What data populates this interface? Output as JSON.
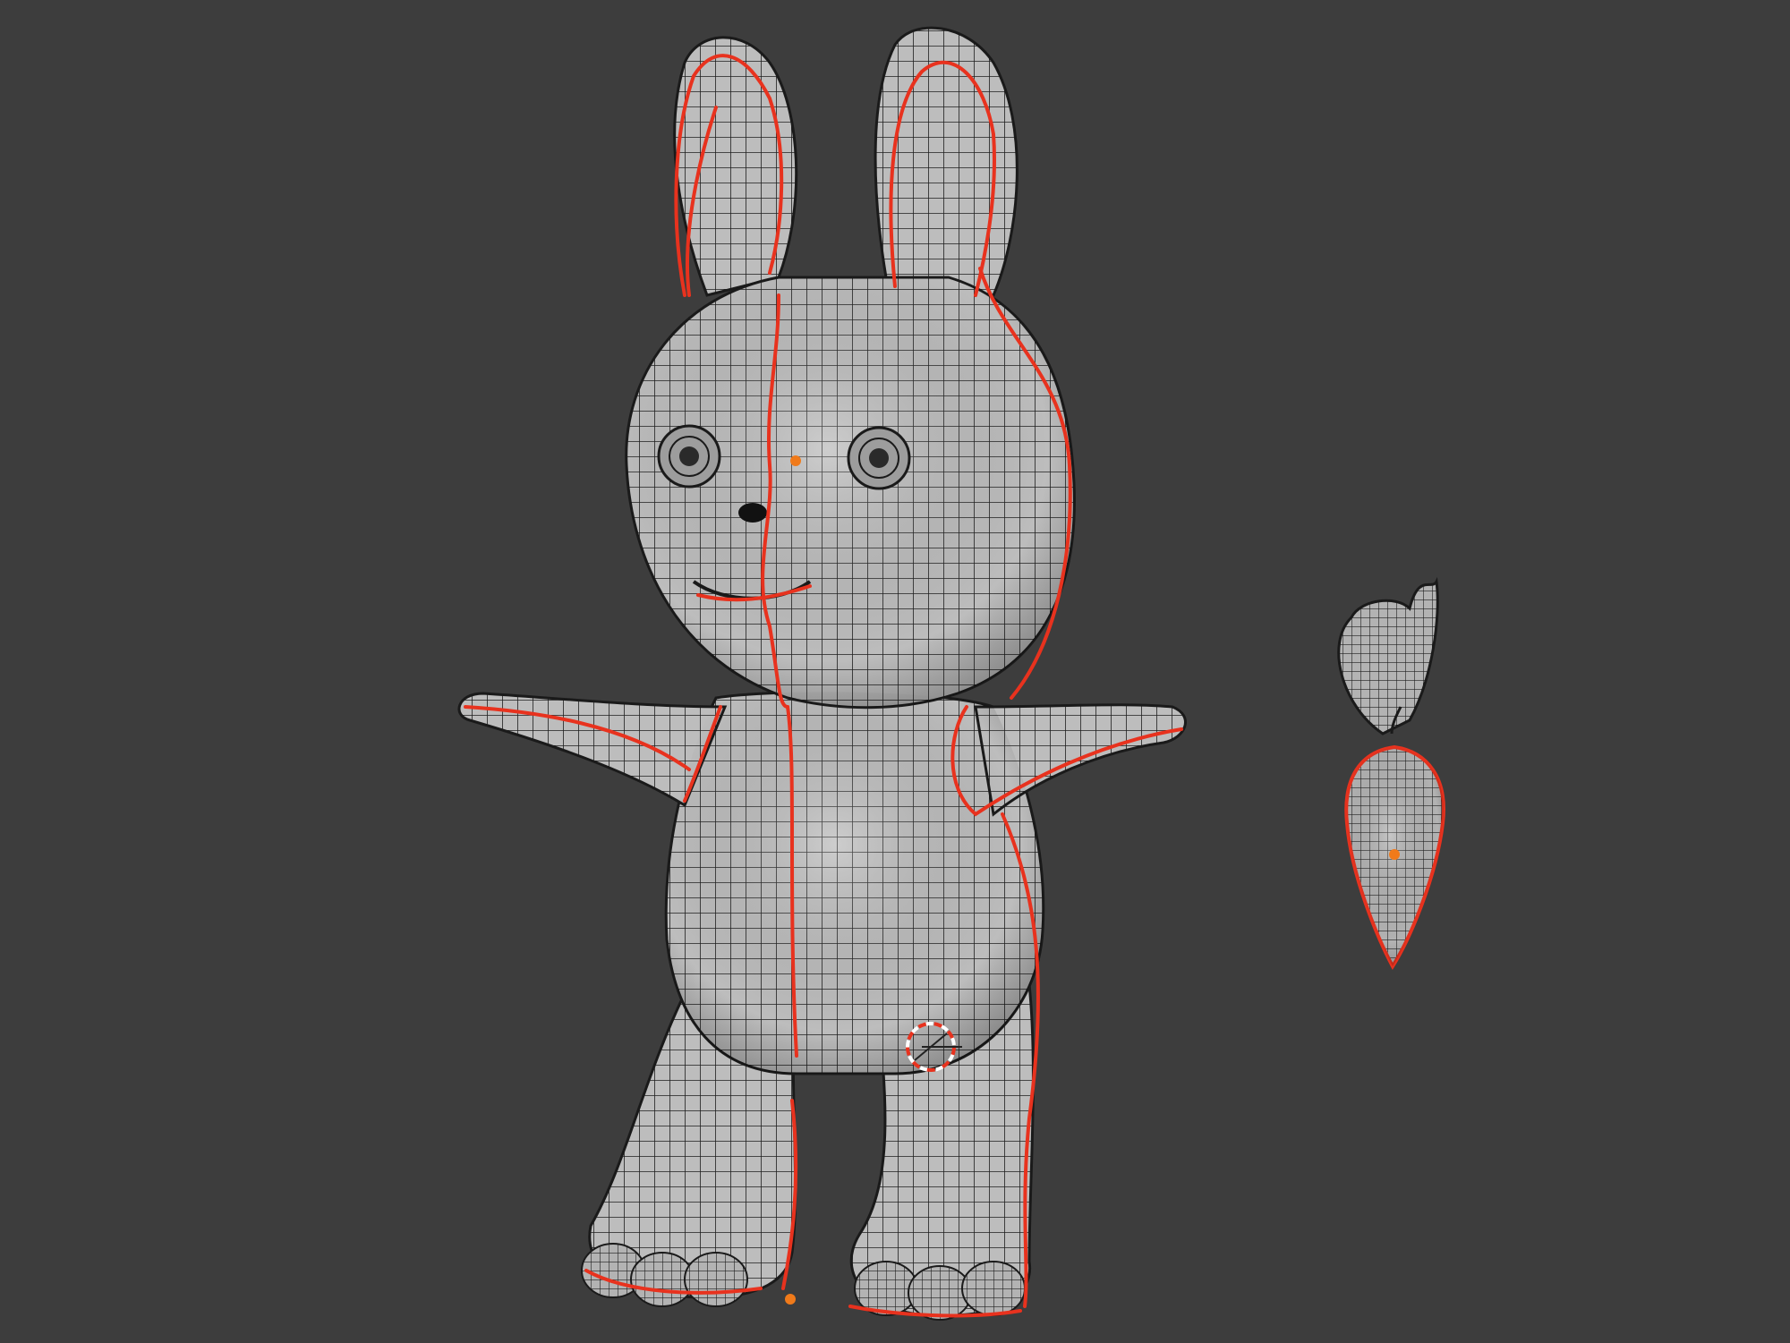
{
  "viewport": {
    "background_color": "#3d3d3d",
    "mesh_fill_color": "#b9b9b9",
    "wire_color": "#1a1a1a",
    "seam_color": "#e8321e",
    "origin_color": "#f07a1a",
    "cursor_color": "#e8321e"
  },
  "objects": [
    {
      "name": "bunny",
      "icon": "bunny-mesh"
    },
    {
      "name": "carrot",
      "icon": "carrot-mesh"
    }
  ],
  "gizmo": {
    "icon": "3d-cursor-icon"
  }
}
